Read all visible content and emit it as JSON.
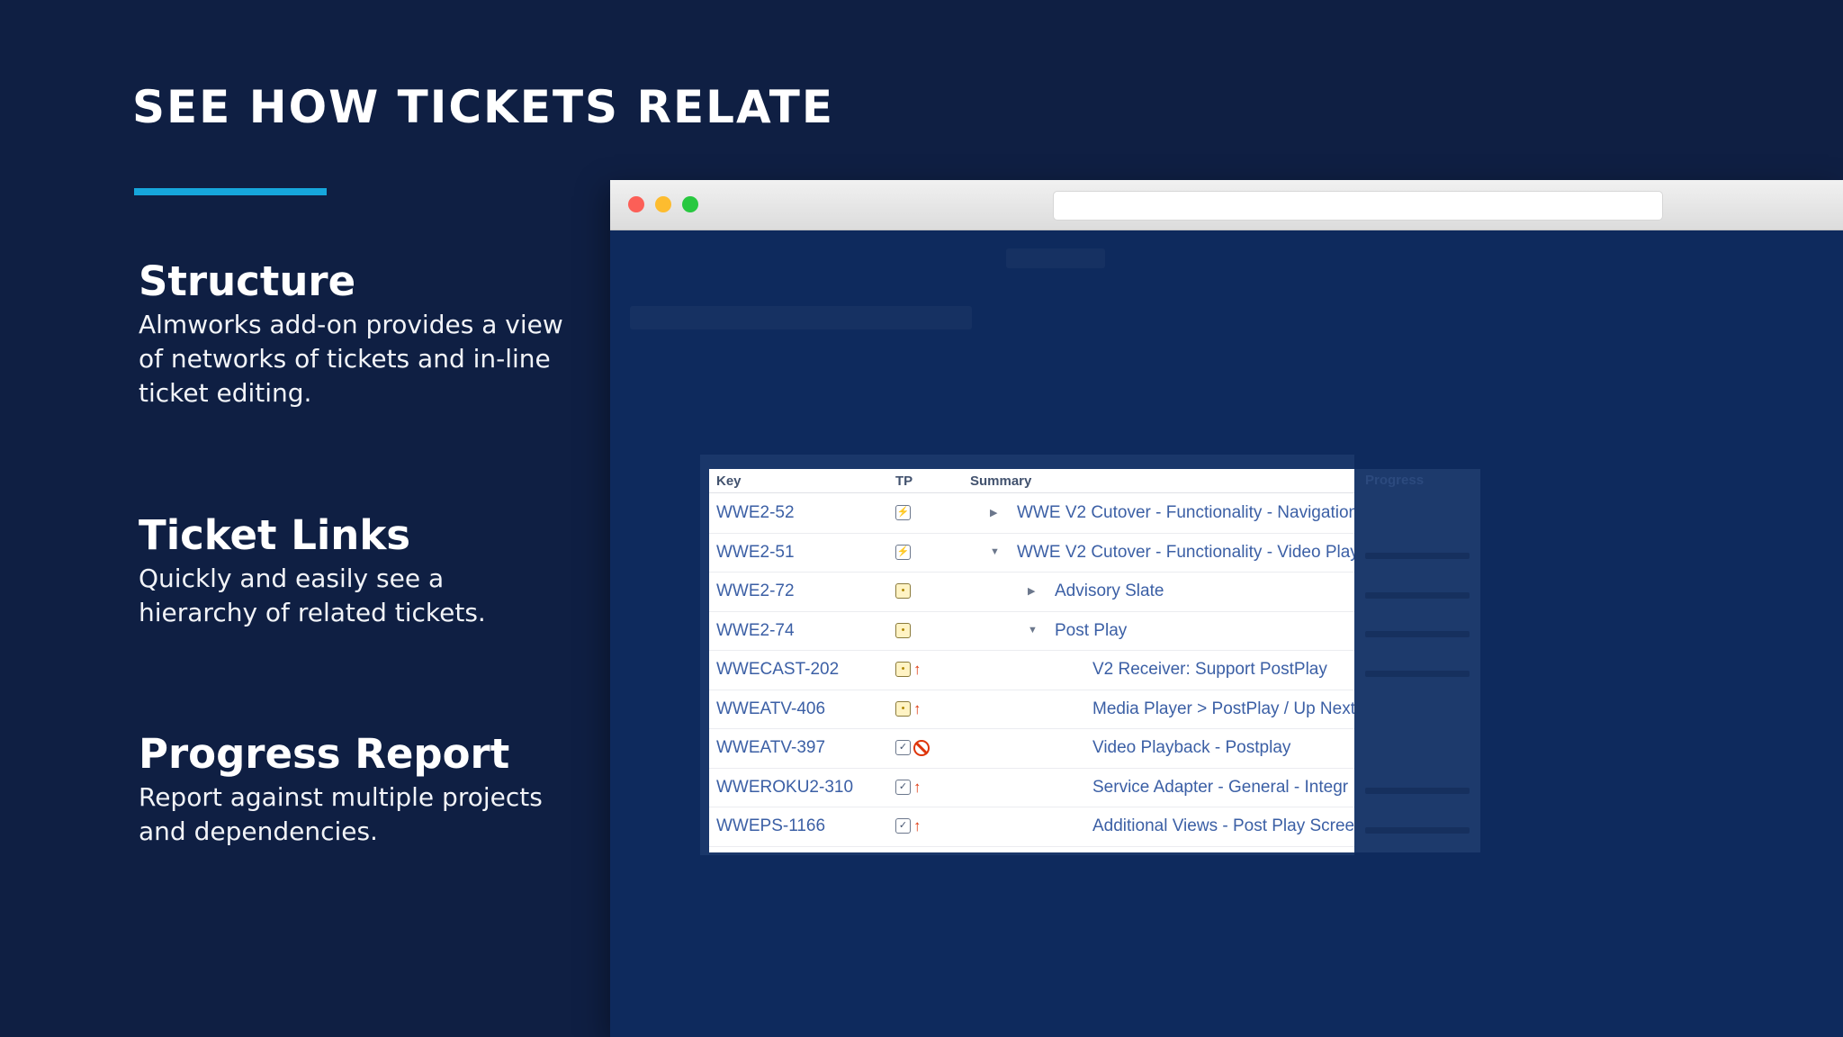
{
  "slide": {
    "title": "SEE HOW TICKETS RELATE",
    "features": [
      {
        "heading": "Structure",
        "body": "Almworks add-on provides a view of networks of tickets and in-line ticket editing."
      },
      {
        "heading": "Ticket Links",
        "body": "Quickly and easily see a hierarchy of related tickets."
      },
      {
        "heading": "Progress Report",
        "body": "Report against multiple projects and dependencies."
      }
    ]
  },
  "colors": {
    "background": "#0f1f43",
    "accent": "#16a6dc",
    "link": "#3b5fa5"
  },
  "table": {
    "headers": {
      "key": "Key",
      "tp": "TP",
      "summary": "Summary",
      "progress": "Progress"
    },
    "rows": [
      {
        "key": "WWE2-52",
        "type_icon": "lightning-icon",
        "priority_icon": "",
        "expander": "collapsed",
        "summary": "WWE V2 Cutover - Functionality - Navigation"
      },
      {
        "key": "WWE2-51",
        "type_icon": "lightning-icon",
        "priority_icon": "",
        "expander": "expanded",
        "summary": "WWE V2 Cutover - Functionality - Video Play"
      },
      {
        "key": "WWE2-72",
        "type_icon": "lightbulb-icon",
        "priority_icon": "",
        "expander": "collapsed",
        "summary": "Advisory Slate"
      },
      {
        "key": "WWE2-74",
        "type_icon": "lightbulb-icon",
        "priority_icon": "",
        "expander": "expanded",
        "summary": "Post Play"
      },
      {
        "key": "WWECAST-202",
        "type_icon": "lightbulb-icon",
        "priority_icon": "arrow-up-icon",
        "expander": "none",
        "summary": "V2 Receiver: Support PostPlay"
      },
      {
        "key": "WWEATV-406",
        "type_icon": "lightbulb-icon",
        "priority_icon": "arrow-up-icon",
        "expander": "none",
        "summary": "Media Player > PostPlay / Up Next"
      },
      {
        "key": "WWEATV-397",
        "type_icon": "checkbox-icon",
        "priority_icon": "blocker-icon",
        "expander": "none",
        "summary": "Video Playback - Postplay"
      },
      {
        "key": "WWEROKU2-310",
        "type_icon": "checkbox-icon",
        "priority_icon": "arrow-up-icon",
        "expander": "none",
        "summary": "Service Adapter - General - Integr"
      },
      {
        "key": "WWEPS-1166",
        "type_icon": "checkbox-icon",
        "priority_icon": "arrow-up-icon",
        "expander": "none",
        "summary": "Additional Views - Post Play Scree"
      }
    ]
  }
}
